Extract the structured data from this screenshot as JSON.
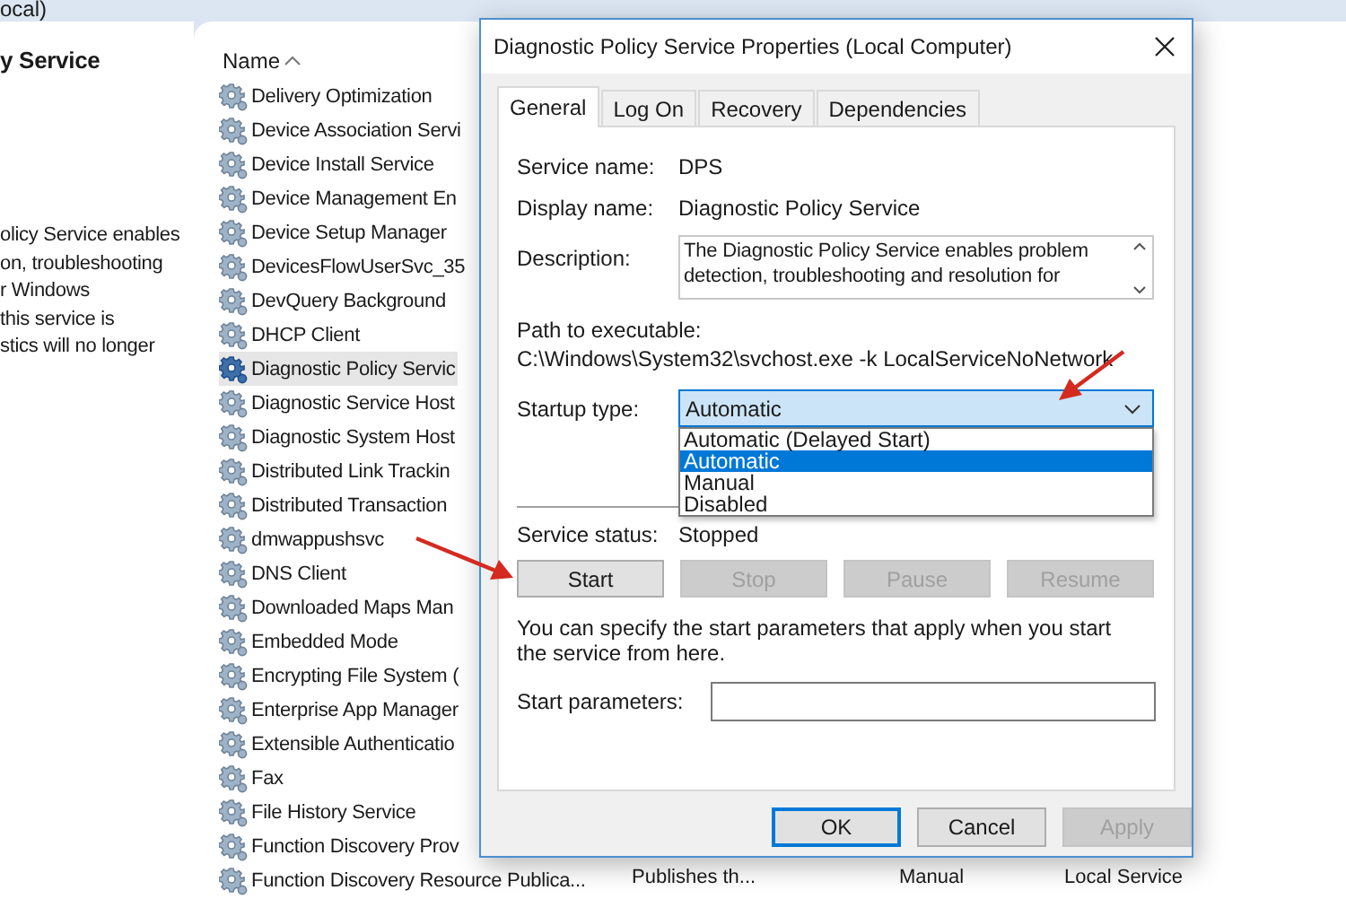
{
  "window": {
    "title_fragment": "ocal)"
  },
  "details_pane": {
    "service_name": "y Service",
    "description_lines": [
      "olicy Service enables",
      "on, troubleshooting",
      "r Windows",
      "this service is",
      "stics will no longer"
    ]
  },
  "services_list": {
    "columns": [
      {
        "label": "Name",
        "sorted": true
      }
    ],
    "rows": [
      {
        "name": "Delivery Optimization",
        "selected": false
      },
      {
        "name": "Device Association Servi",
        "selected": false
      },
      {
        "name": "Device Install Service",
        "selected": false
      },
      {
        "name": "Device Management En",
        "selected": false
      },
      {
        "name": "Device Setup Manager",
        "selected": false
      },
      {
        "name": "DevicesFlowUserSvc_35",
        "selected": false
      },
      {
        "name": "DevQuery Background",
        "selected": false
      },
      {
        "name": "DHCP Client",
        "selected": false
      },
      {
        "name": "Diagnostic Policy Servic",
        "selected": true
      },
      {
        "name": "Diagnostic Service Host",
        "selected": false
      },
      {
        "name": "Diagnostic System Host",
        "selected": false
      },
      {
        "name": "Distributed Link Trackin",
        "selected": false
      },
      {
        "name": "Distributed Transaction",
        "selected": false
      },
      {
        "name": "dmwappushsvc",
        "selected": false
      },
      {
        "name": "DNS Client",
        "selected": false
      },
      {
        "name": "Downloaded Maps Man",
        "selected": false
      },
      {
        "name": "Embedded Mode",
        "selected": false
      },
      {
        "name": "Encrypting File System (",
        "selected": false
      },
      {
        "name": "Enterprise App Manager",
        "selected": false
      },
      {
        "name": "Extensible Authenticatio",
        "selected": false
      },
      {
        "name": "Fax",
        "selected": false
      },
      {
        "name": "File History Service",
        "selected": false
      },
      {
        "name": "Function Discovery Prov",
        "selected": false
      },
      {
        "name": "Function Discovery Resource Publica...",
        "description": "Publishes th...",
        "startup_type": "Manual",
        "log_on_as": "Local Service",
        "selected": false
      }
    ]
  },
  "dialog": {
    "title": "Diagnostic Policy Service Properties (Local Computer)",
    "tabs": [
      {
        "label": "General",
        "selected": true
      },
      {
        "label": "Log On",
        "selected": false
      },
      {
        "label": "Recovery",
        "selected": false
      },
      {
        "label": "Dependencies",
        "selected": false
      }
    ],
    "service_name_label": "Service name:",
    "service_name": "DPS",
    "display_name_label": "Display name:",
    "display_name": "Diagnostic Policy Service",
    "description_label": "Description:",
    "description": "The Diagnostic Policy Service enables problem detection, troubleshooting and resolution for",
    "path_label": "Path to executable:",
    "path": "C:\\Windows\\System32\\svchost.exe -k LocalServiceNoNetwork",
    "startup_type_label": "Startup type:",
    "startup_type": {
      "value": "Automatic",
      "expanded": true,
      "options": [
        {
          "label": "Automatic (Delayed Start)",
          "selected": false
        },
        {
          "label": "Automatic",
          "selected": true
        },
        {
          "label": "Manual",
          "selected": false
        },
        {
          "label": "Disabled",
          "selected": false
        }
      ]
    },
    "service_status_label": "Service status:",
    "service_status": "Stopped",
    "service_buttons": [
      {
        "label": "Start",
        "disabled": false
      },
      {
        "label": "Stop",
        "disabled": true
      },
      {
        "label": "Pause",
        "disabled": true
      },
      {
        "label": "Resume",
        "disabled": true
      }
    ],
    "hint": "You can specify the start parameters that apply when you start the service from here.",
    "start_parameters_label": "Start parameters:",
    "footer_buttons": [
      {
        "label": "OK",
        "disabled": false,
        "default": true
      },
      {
        "label": "Cancel",
        "disabled": false,
        "default": false
      },
      {
        "label": "Apply",
        "disabled": true,
        "default": false
      }
    ]
  }
}
